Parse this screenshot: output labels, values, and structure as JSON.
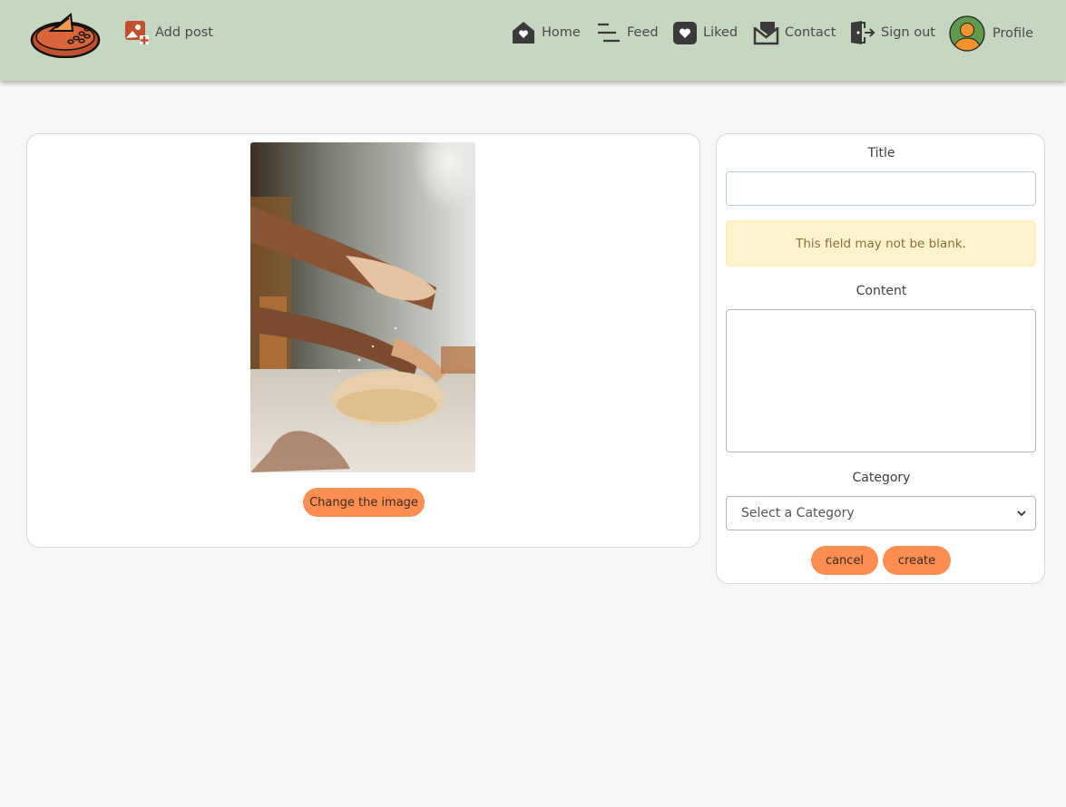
{
  "nav": {
    "add_post": "Add post",
    "home": "Home",
    "feed": "Feed",
    "liked": "Liked",
    "contact": "Contact",
    "sign_out": "Sign out",
    "profile": "Profile"
  },
  "image_panel": {
    "change_button": "Change the image"
  },
  "form": {
    "title_label": "Title",
    "title_value": "",
    "title_error": "This field may not be blank.",
    "content_label": "Content",
    "content_value": "",
    "category_label": "Category",
    "category_selected": "Select a Category",
    "cancel_label": "cancel",
    "create_label": "create"
  },
  "colors": {
    "navbar_bg": "#c6d6c1",
    "accent": "#fc8e52",
    "alert_bg": "#fff3cd"
  },
  "icons": [
    "bread-logo",
    "add-image-icon",
    "home-heart-icon",
    "feed-lines-icon",
    "heart-square-icon",
    "mail-icon",
    "sign-out-icon",
    "avatar"
  ]
}
